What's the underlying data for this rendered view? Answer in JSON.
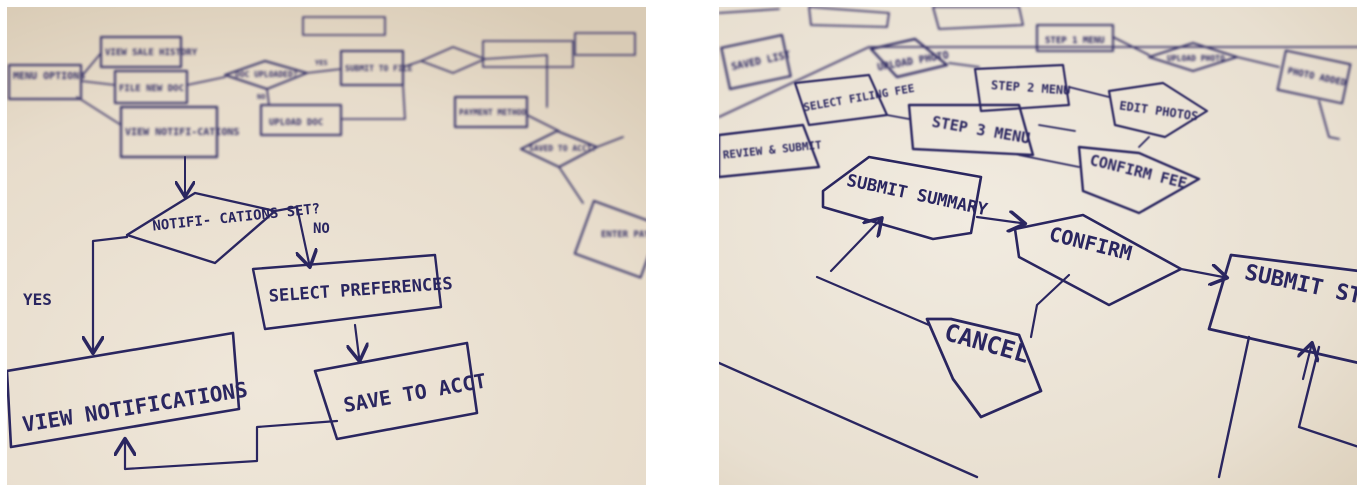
{
  "left_photo": {
    "top_rows": {
      "menu_options": "MENU OPTIONS",
      "view_sale_history": "VIEW SALE HISTORY",
      "file_new_doc": "FILE NEW DOC",
      "view_notifications_box": "VIEW NOTIFI-CATIONS",
      "doc_uploaded": "DOC UPLOADED?",
      "upload_doc": "UPLOAD DOC",
      "submit_to_file": "SUBMIT TO FILE",
      "yes": "YES",
      "no": "NO",
      "payment_method": "PAYMENT METHOD",
      "saved_to_acct": "SAVED TO ACCT?",
      "enter_pay": "ENTER PAY"
    },
    "decision": "NOTIFI- CATIONS SET?",
    "branch_yes": "YES",
    "branch_no": "NO",
    "select_preferences": "SELECT PREFERENCES",
    "view_notifications": "VIEW NOTIFICATIONS",
    "save_to_acct": "SAVE TO ACCT"
  },
  "right_photo": {
    "saved_list": "SAVED LIST",
    "select_filing_fee": "SELECT FILING FEE",
    "step_2_menu": "STEP 2 MENU",
    "step_1_menu": "STEP 1 MENU",
    "upload_photo": "UPLOAD PHOTO",
    "photo_added": "PHOTO ADDED",
    "edit_photos": "EDIT PHOTOS",
    "step_3_menu": "STEP 3 MENU",
    "review_submit": "REVIEW & SUBMIT",
    "confirm_fee": "CONFIRM FEE",
    "submit_summary": "SUBMIT SUMMARY",
    "confirm": "CONFIRM",
    "cancel": "CANCEL",
    "submit_status": "SUBMIT STATUS"
  }
}
